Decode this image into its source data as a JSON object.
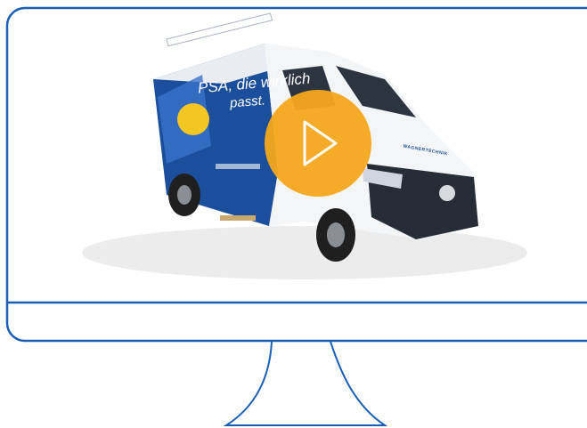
{
  "video": {
    "slogan_line1": "PSA, die wirklich",
    "slogan_line2": "passt.",
    "brand_text": "WAGNERTECHNIK"
  },
  "icons": {
    "play": "play-icon",
    "monitor": "monitor-icon"
  },
  "colors": {
    "monitor_stroke": "#1a5fb4",
    "play_button": "#f5a61c",
    "van_blue": "#1b4e9b",
    "van_white": "#f4f5f7"
  }
}
